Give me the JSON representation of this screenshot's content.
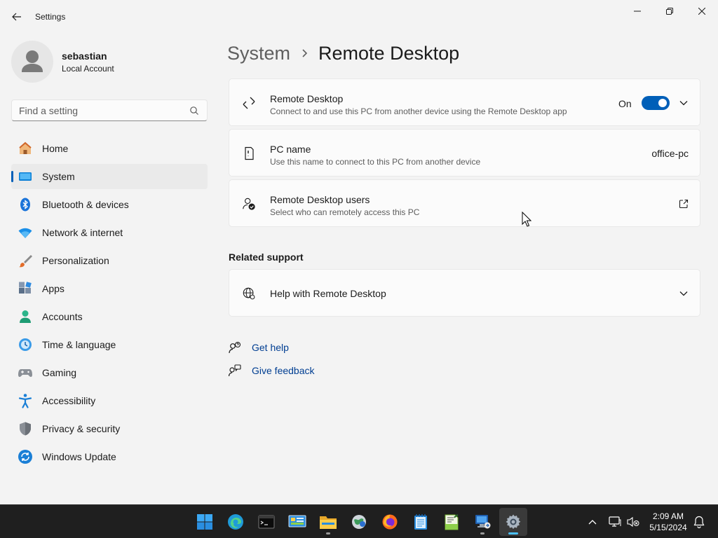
{
  "window": {
    "title": "Settings"
  },
  "profile": {
    "name": "sebastian",
    "account_type": "Local Account"
  },
  "search": {
    "placeholder": "Find a setting"
  },
  "nav": {
    "items": [
      {
        "label": "Home",
        "icon": "home-icon"
      },
      {
        "label": "System",
        "icon": "system-icon",
        "selected": true
      },
      {
        "label": "Bluetooth & devices",
        "icon": "bluetooth-icon"
      },
      {
        "label": "Network & internet",
        "icon": "wifi-icon"
      },
      {
        "label": "Personalization",
        "icon": "brush-icon"
      },
      {
        "label": "Apps",
        "icon": "apps-icon"
      },
      {
        "label": "Accounts",
        "icon": "person-icon"
      },
      {
        "label": "Time & language",
        "icon": "clock-globe-icon"
      },
      {
        "label": "Gaming",
        "icon": "gamepad-icon"
      },
      {
        "label": "Accessibility",
        "icon": "accessibility-icon"
      },
      {
        "label": "Privacy & security",
        "icon": "shield-icon"
      },
      {
        "label": "Windows Update",
        "icon": "update-icon"
      }
    ]
  },
  "breadcrumb": {
    "parent": "System",
    "current": "Remote Desktop"
  },
  "cards": {
    "remote_desktop": {
      "title": "Remote Desktop",
      "description": "Connect to and use this PC from another device using the Remote Desktop app",
      "toggle_label": "On",
      "toggle_on": true
    },
    "pc_name": {
      "title": "PC name",
      "description": "Use this name to connect to this PC from another device",
      "value": "office-pc"
    },
    "users": {
      "title": "Remote Desktop users",
      "description": "Select who can remotely access this PC"
    }
  },
  "related_support": {
    "heading": "Related support",
    "help_title": "Help with Remote Desktop"
  },
  "links": {
    "get_help": "Get help",
    "give_feedback": "Give feedback"
  },
  "taskbar": {
    "apps": [
      "start",
      "edge",
      "terminal",
      "control-panel",
      "file-explorer",
      "network-app",
      "firefox",
      "notepad",
      "notepad-plus",
      "remote-desktop",
      "settings"
    ],
    "time": "2:09 AM",
    "date": "5/15/2024"
  },
  "colors": {
    "accent": "#005fb8",
    "link": "#003e92",
    "background": "#f3f3f3",
    "taskbar": "#1f1f1f"
  }
}
